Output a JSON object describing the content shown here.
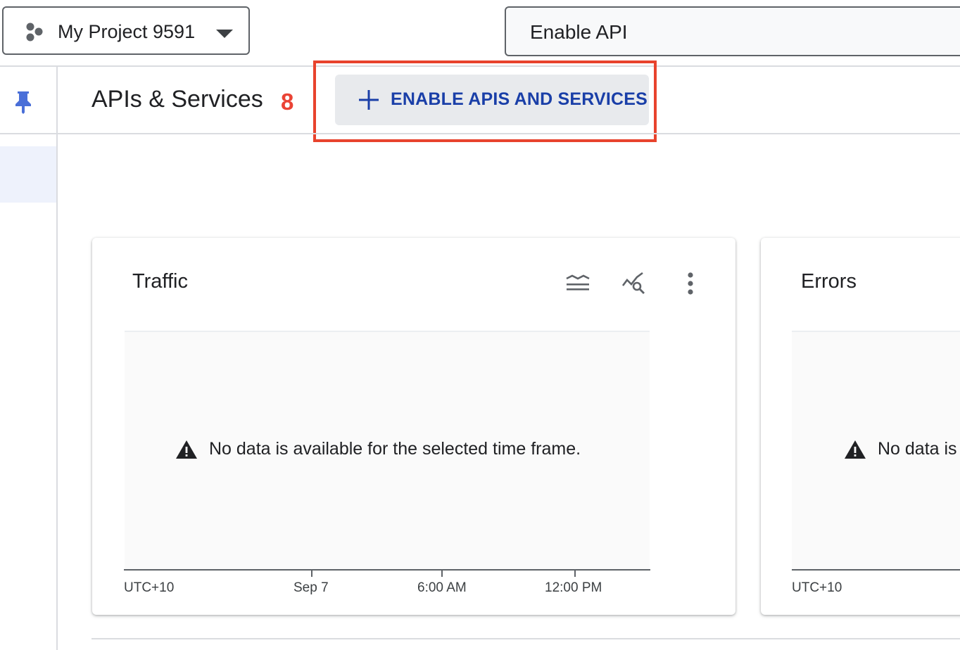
{
  "project": {
    "name": "My Project 9591"
  },
  "search": {
    "value": "Enable API"
  },
  "header": {
    "title": "APIs & Services",
    "annotation_number": "8",
    "enable_button_label": "ENABLE APIS AND SERVICES"
  },
  "traffic_card": {
    "title": "Traffic",
    "no_data_message": "No data is available for the selected time frame.",
    "x_axis_labels": [
      "UTC+10",
      "Sep 7",
      "6:00 AM",
      "12:00 PM"
    ]
  },
  "errors_card": {
    "title": "Errors",
    "no_data_message": "No data is",
    "x_axis_labels": [
      "UTC+10"
    ]
  },
  "icons": {
    "project": "project-hierarchy-icon",
    "dropdown": "caret-down-icon",
    "pin": "pin-icon",
    "plus": "plus-icon",
    "legend": "legend-icon",
    "explore": "explore-chart-icon",
    "more": "more-vert-icon",
    "warning": "warning-icon"
  },
  "colors": {
    "accent_blue": "#1a3fa8",
    "pin_blue": "#4a6fd8",
    "highlight_red": "#e8432d",
    "badge_red": "#ea4335"
  }
}
